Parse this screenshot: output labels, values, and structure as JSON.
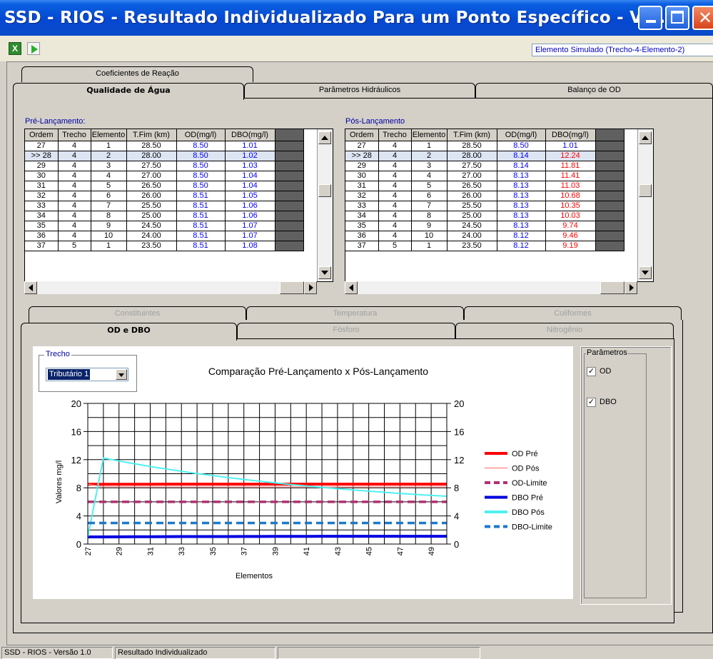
{
  "window": {
    "title": "SSD - RIOS - Resultado Individualizado Para um Ponto Específico - Ve..."
  },
  "toolbar": {
    "elemento_simulado": "Elemento Simulado (Trecho-4-Elemento-2)"
  },
  "top_tabs": {
    "coeficientes": "Coeficientes de Reação",
    "qualidade": "Qualidade de Água",
    "hidraulicos": "Parâmetros Hidráulicos",
    "balanco": "Balanço de OD"
  },
  "pre": {
    "label": "Pré-Lançamento:",
    "columns": [
      "Ordem",
      "Trecho",
      "Elemento",
      "T.Fim (km)",
      "OD(mg/l)",
      "DBO(mg/l)"
    ],
    "rows": [
      [
        "27",
        "4",
        "1",
        "28.50",
        "8.50",
        "1.01"
      ],
      [
        ">> 28",
        "4",
        "2",
        "28.00",
        "8.50",
        "1.02"
      ],
      [
        "29",
        "4",
        "3",
        "27.50",
        "8.50",
        "1.03"
      ],
      [
        "30",
        "4",
        "4",
        "27.00",
        "8.50",
        "1.04"
      ],
      [
        "31",
        "4",
        "5",
        "26.50",
        "8.50",
        "1.04"
      ],
      [
        "32",
        "4",
        "6",
        "26.00",
        "8.51",
        "1.05"
      ],
      [
        "33",
        "4",
        "7",
        "25.50",
        "8.51",
        "1.06"
      ],
      [
        "34",
        "4",
        "8",
        "25.00",
        "8.51",
        "1.06"
      ],
      [
        "35",
        "4",
        "9",
        "24.50",
        "8.51",
        "1.07"
      ],
      [
        "36",
        "4",
        "10",
        "24.00",
        "8.51",
        "1.07"
      ],
      [
        "37",
        "5",
        "1",
        "23.50",
        "8.51",
        "1.08"
      ]
    ]
  },
  "pos": {
    "label": "Pós-Lançamento",
    "columns": [
      "Ordem",
      "Trecho",
      "Elemento",
      "T.Fim (km)",
      "OD(mg/l)",
      "DBO(mg/l)"
    ],
    "rows": [
      [
        "27",
        "4",
        "1",
        "28.50",
        "8.50",
        "1.01"
      ],
      [
        ">> 28",
        "4",
        "2",
        "28.00",
        "8.14",
        "12.24"
      ],
      [
        "29",
        "4",
        "3",
        "27.50",
        "8.14",
        "11.81"
      ],
      [
        "30",
        "4",
        "4",
        "27.00",
        "8.13",
        "11.41"
      ],
      [
        "31",
        "4",
        "5",
        "26.50",
        "8.13",
        "11.03"
      ],
      [
        "32",
        "4",
        "6",
        "26.00",
        "8.13",
        "10.68"
      ],
      [
        "33",
        "4",
        "7",
        "25.50",
        "8.13",
        "10.35"
      ],
      [
        "34",
        "4",
        "8",
        "25.00",
        "8.13",
        "10.03"
      ],
      [
        "35",
        "4",
        "9",
        "24.50",
        "8.13",
        "9.74"
      ],
      [
        "36",
        "4",
        "10",
        "24.00",
        "8.12",
        "9.46"
      ],
      [
        "37",
        "5",
        "1",
        "23.50",
        "8.12",
        "9.19"
      ]
    ]
  },
  "bottom_tabs": {
    "constituintes": "Constituintes",
    "temperatura": "Temperatura",
    "coliformes": "Coliformes",
    "od_dbo": "OD e DBO",
    "fosforo": "Fósforo",
    "nitrogenio": "Nitrogênio"
  },
  "trecho": {
    "label": "Trecho",
    "selected": "Tributário 1"
  },
  "parametros": {
    "label": "Parâmetros",
    "od": "OD",
    "dbo": "DBO",
    "od_checked": true,
    "dbo_checked": true
  },
  "chart_data": {
    "type": "line",
    "title": "Comparação Pré-Lançamento  x  Pós-Lançamento",
    "xlabel": "Elementos",
    "ylabel": "Valores mg/l",
    "x": [
      27,
      28,
      29,
      30,
      31,
      32,
      33,
      34,
      35,
      36,
      37,
      38,
      39,
      40,
      41,
      42,
      43,
      44,
      45,
      46,
      47,
      48,
      49,
      50
    ],
    "x_tick_labels": [
      "27",
      "29",
      "31",
      "33",
      "35",
      "37",
      "39",
      "41",
      "43",
      "45",
      "47",
      "49"
    ],
    "ylim": [
      0,
      20
    ],
    "y_ticks": [
      0,
      4,
      8,
      12,
      16,
      20
    ],
    "y_tick_labels": [
      "0",
      "4",
      "8",
      "12",
      "16",
      "20"
    ],
    "grid": true,
    "legend_position": "right",
    "series": [
      {
        "name": "OD Pré",
        "color": "#ff0000",
        "style": "solid-thick",
        "values": [
          8.5,
          8.5,
          8.5,
          8.5,
          8.5,
          8.51,
          8.51,
          8.51,
          8.51,
          8.51,
          8.51,
          8.51,
          8.51,
          8.51,
          8.51,
          8.51,
          8.51,
          8.51,
          8.51,
          8.51,
          8.51,
          8.51,
          8.51,
          8.51
        ]
      },
      {
        "name": "OD Pós",
        "color": "#ff9090",
        "style": "solid-thin",
        "values": [
          8.5,
          8.14,
          8.14,
          8.13,
          8.13,
          8.13,
          8.13,
          8.13,
          8.13,
          8.12,
          8.12,
          8.12,
          8.12,
          8.12,
          8.12,
          8.12,
          8.12,
          8.12,
          8.12,
          8.12,
          8.12,
          8.12,
          8.12,
          8.12
        ]
      },
      {
        "name": "OD-Limite",
        "color": "#b03070",
        "style": "dashed",
        "values": [
          6,
          6,
          6,
          6,
          6,
          6,
          6,
          6,
          6,
          6,
          6,
          6,
          6,
          6,
          6,
          6,
          6,
          6,
          6,
          6,
          6,
          6,
          6,
          6
        ]
      },
      {
        "name": "DBO Pré",
        "color": "#0000e0",
        "style": "solid-thick",
        "values": [
          1.01,
          1.02,
          1.03,
          1.04,
          1.04,
          1.05,
          1.06,
          1.06,
          1.07,
          1.07,
          1.08,
          1.08,
          1.09,
          1.09,
          1.09,
          1.1,
          1.1,
          1.1,
          1.1,
          1.11,
          1.11,
          1.11,
          1.11,
          1.11
        ]
      },
      {
        "name": "DBO Pós",
        "color": "#50f0f0",
        "style": "solid",
        "values": [
          1.01,
          12.24,
          11.81,
          11.41,
          11.03,
          10.68,
          10.35,
          10.03,
          9.74,
          9.46,
          9.19,
          8.94,
          8.7,
          8.47,
          8.26,
          8.06,
          7.87,
          7.69,
          7.52,
          7.36,
          7.2,
          7.06,
          6.92,
          6.8
        ]
      },
      {
        "name": "DBO-Limite",
        "color": "#1e78c8",
        "style": "dashed",
        "values": [
          3,
          3,
          3,
          3,
          3,
          3,
          3,
          3,
          3,
          3,
          3,
          3,
          3,
          3,
          3,
          3,
          3,
          3,
          3,
          3,
          3,
          3,
          3,
          3
        ]
      }
    ]
  },
  "status": {
    "version": "SSD - RIOS - Versão 1.0",
    "screen": "Resultado Individualizado"
  }
}
